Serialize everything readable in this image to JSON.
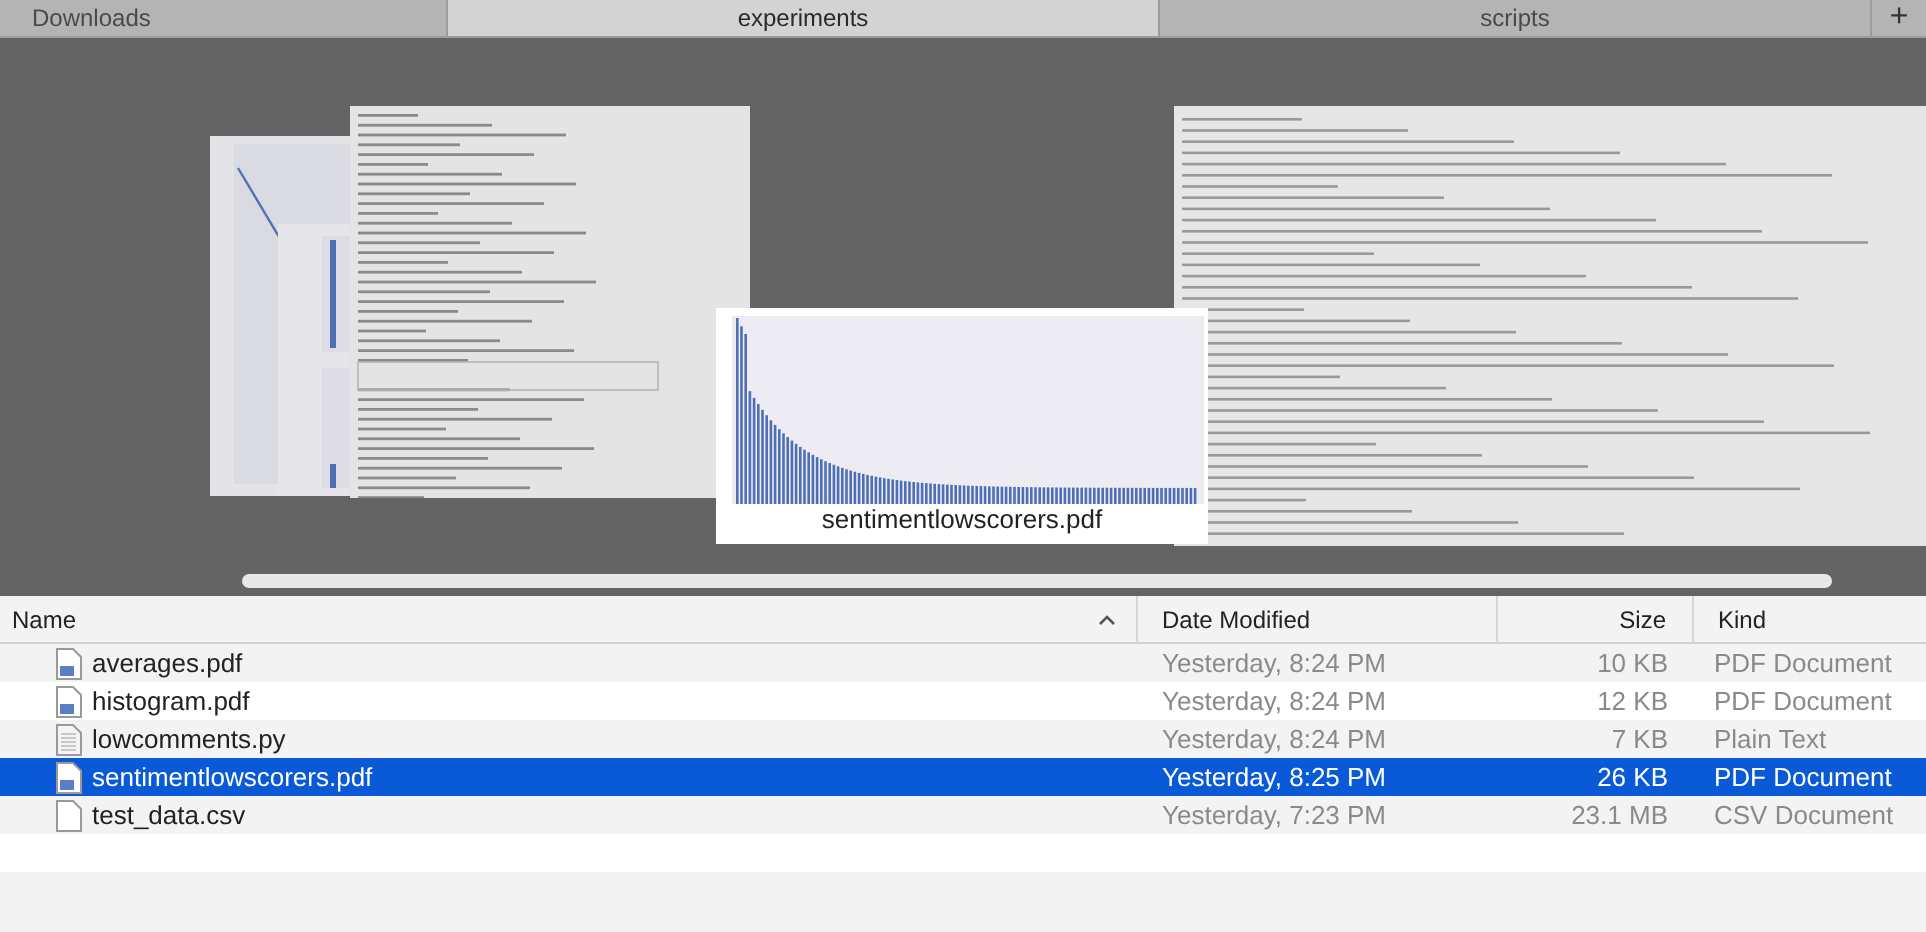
{
  "tabs": [
    {
      "label": "Downloads",
      "selected": false
    },
    {
      "label": "experiments",
      "selected": true
    },
    {
      "label": "scripts",
      "selected": false
    }
  ],
  "new_tab_button": "+",
  "cover_flow": {
    "caption": "sentimentlowscorers.pdf"
  },
  "columns": [
    {
      "label": "Name",
      "sorted": true
    },
    {
      "label": "Date Modified",
      "sorted": false
    },
    {
      "label": "Size",
      "sorted": false
    },
    {
      "label": "Kind",
      "sorted": false
    }
  ],
  "rows": [
    {
      "kind": "pdf",
      "name": "averages.pdf",
      "date_modified": "Yesterday, 8:24 PM",
      "size": "10 KB",
      "file_kind": "PDF Document",
      "selected": false
    },
    {
      "kind": "pdf",
      "name": "histogram.pdf",
      "date_modified": "Yesterday, 8:24 PM",
      "size": "12 KB",
      "file_kind": "PDF Document",
      "selected": false
    },
    {
      "kind": "text",
      "name": "lowcomments.py",
      "date_modified": "Yesterday, 8:24 PM",
      "size": "7 KB",
      "file_kind": "Plain Text",
      "selected": false
    },
    {
      "kind": "pdf",
      "name": "sentimentlowscorers.pdf",
      "date_modified": "Yesterday, 8:25 PM",
      "size": "26 KB",
      "file_kind": "PDF Document",
      "selected": true
    },
    {
      "kind": "blank",
      "name": "test_data.csv",
      "date_modified": "Yesterday, 7:23 PM",
      "size": "23.1 MB",
      "file_kind": "CSV Document",
      "selected": false
    }
  ]
}
